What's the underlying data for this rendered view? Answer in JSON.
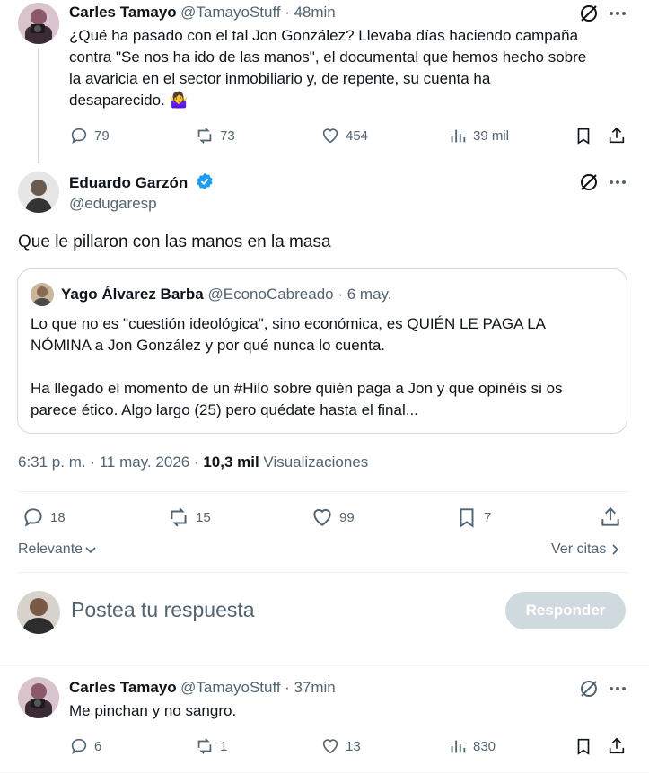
{
  "tweet1": {
    "name": "Carles Tamayo",
    "handle": "@TamayoStuff",
    "time": "· 48min",
    "text_lines": [
      "¿Qué ha pasado con el tal Jon González? Llevaba días haciendo campaña",
      "contra \"Se nos ha ido de las manos\", el documental que hemos hecho sobre",
      "la avaricia en el sector inmobiliario y, de repente, su cuenta ha",
      "desaparecido. 🤷‍♀️"
    ],
    "replies": "79",
    "retweets": "73",
    "likes": "454",
    "views": "39 mil"
  },
  "main": {
    "name": "Eduardo Garzón",
    "handle": "@edugaresp",
    "text": "Que le pillaron con las manos en la masa",
    "quote": {
      "name": "Yago Álvarez Barba",
      "handle": "@EconoCabreado",
      "time": "· 6 may.",
      "line1": "Lo que no es \"cuestión ideológica\", sino económica, es QUIÉN LE PAGA LA",
      "line2": "NÓMINA a Jon González y por qué nunca lo cuenta.",
      "line3": "Ha llegado el momento de un #Hilo sobre quién paga a Jon y que opinéis si os",
      "line4": "parece ético. Algo largo (25) pero quédate hasta el final..."
    },
    "timestamp": "6:31 p. m. · 11 may. 2026 · ",
    "views_count": "10,3 mil",
    "views_label": " Visualizaciones",
    "replies": "18",
    "retweets": "15",
    "likes": "99",
    "bookmarks": "7"
  },
  "filter": {
    "relevant": "Relevante",
    "quotes": "Ver citas"
  },
  "compose": {
    "placeholder": "Postea tu respuesta",
    "button": "Responder"
  },
  "reply": {
    "name": "Carles Tamayo",
    "handle": "@TamayoStuff",
    "time": "· 37min",
    "text": "Me pinchan y no sangro.",
    "replies": "6",
    "retweets": "1",
    "likes": "13",
    "views": "830"
  },
  "colors": {
    "accent": "#1d9bf0",
    "muted": "#536471",
    "button_disabled": "#cfd9de"
  }
}
